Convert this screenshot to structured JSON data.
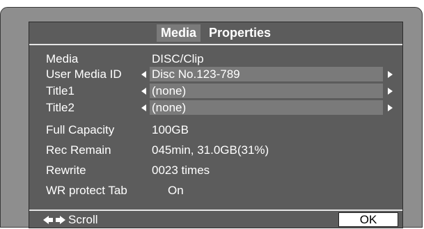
{
  "tabs": [
    {
      "label": "Media",
      "active": true
    },
    {
      "label": "Properties",
      "active": false
    }
  ],
  "rows": [
    {
      "label": "Media",
      "value": "DISC/Clip",
      "editable": false
    },
    {
      "label": "User Media ID",
      "value": "Disc No.123-789",
      "editable": true
    },
    {
      "label": "Title1",
      "value": "(none)",
      "editable": true
    },
    {
      "label": "Title2",
      "value": "(none)",
      "editable": true
    },
    {
      "label": "Full Capacity",
      "value": "100GB",
      "editable": false
    },
    {
      "label": "Rec Remain",
      "value": "045min, 31.0GB(31%)",
      "editable": false
    },
    {
      "label": "Rewrite",
      "value": "0023 times",
      "editable": false
    },
    {
      "label": "WR protect Tab",
      "value": "On",
      "editable": false
    }
  ],
  "footer": {
    "scroll_label": "Scroll",
    "scroll_icon": "left-right-arrows-icon",
    "ok_label": "OK"
  },
  "colors": {
    "frame": "#8e8e8e",
    "screen": "#5c5c5c",
    "field": "#7a7a7a",
    "text": "#ffffff"
  }
}
